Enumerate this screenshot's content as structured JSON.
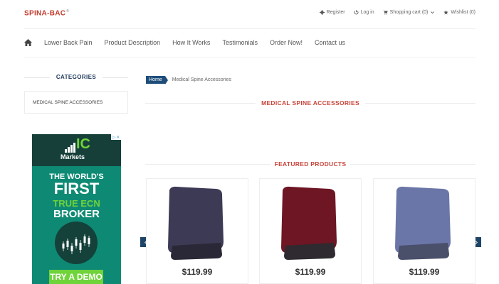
{
  "brand": {
    "name": "SPINA-BAC",
    "mark": "®"
  },
  "top_links": {
    "register": "Register",
    "login": "Log in",
    "cart": "Shopping cart (0)",
    "wishlist": "Wishlist (0)"
  },
  "nav": {
    "items": [
      "Lower Back Pain",
      "Product Description",
      "How It Works",
      "Testimonials",
      "Order Now!",
      "Contact us"
    ]
  },
  "sidebar": {
    "categories_title": "CATEGORIES",
    "category": "MEDICAL SPINE ACCESSORIES"
  },
  "ad": {
    "brand_big": "IC",
    "brand_small": "Markets",
    "line1": "THE WORLD'S",
    "line2": "FIRST",
    "line3": "TRUE ECN",
    "line4": "BROKER",
    "cta": "TRY A DEMO",
    "accent_color": "#6fd33a",
    "bg_color": "#0e8a74"
  },
  "breadcrumb": {
    "home": "Home",
    "current": "Medical Spine Accessories"
  },
  "main": {
    "category_heading": "MEDICAL SPINE ACCESSORIES",
    "featured_heading": "FEATURED PRODUCTS",
    "products": [
      {
        "price": "$119.99",
        "color": "#3d3a55"
      },
      {
        "price": "$119.99",
        "color": "#6e1624"
      },
      {
        "price": "$119.99",
        "color": "#6b76a8"
      }
    ]
  },
  "colors": {
    "brand_red": "#c0392b",
    "navy": "#1f4d7a",
    "heading_red": "#c9443a"
  }
}
